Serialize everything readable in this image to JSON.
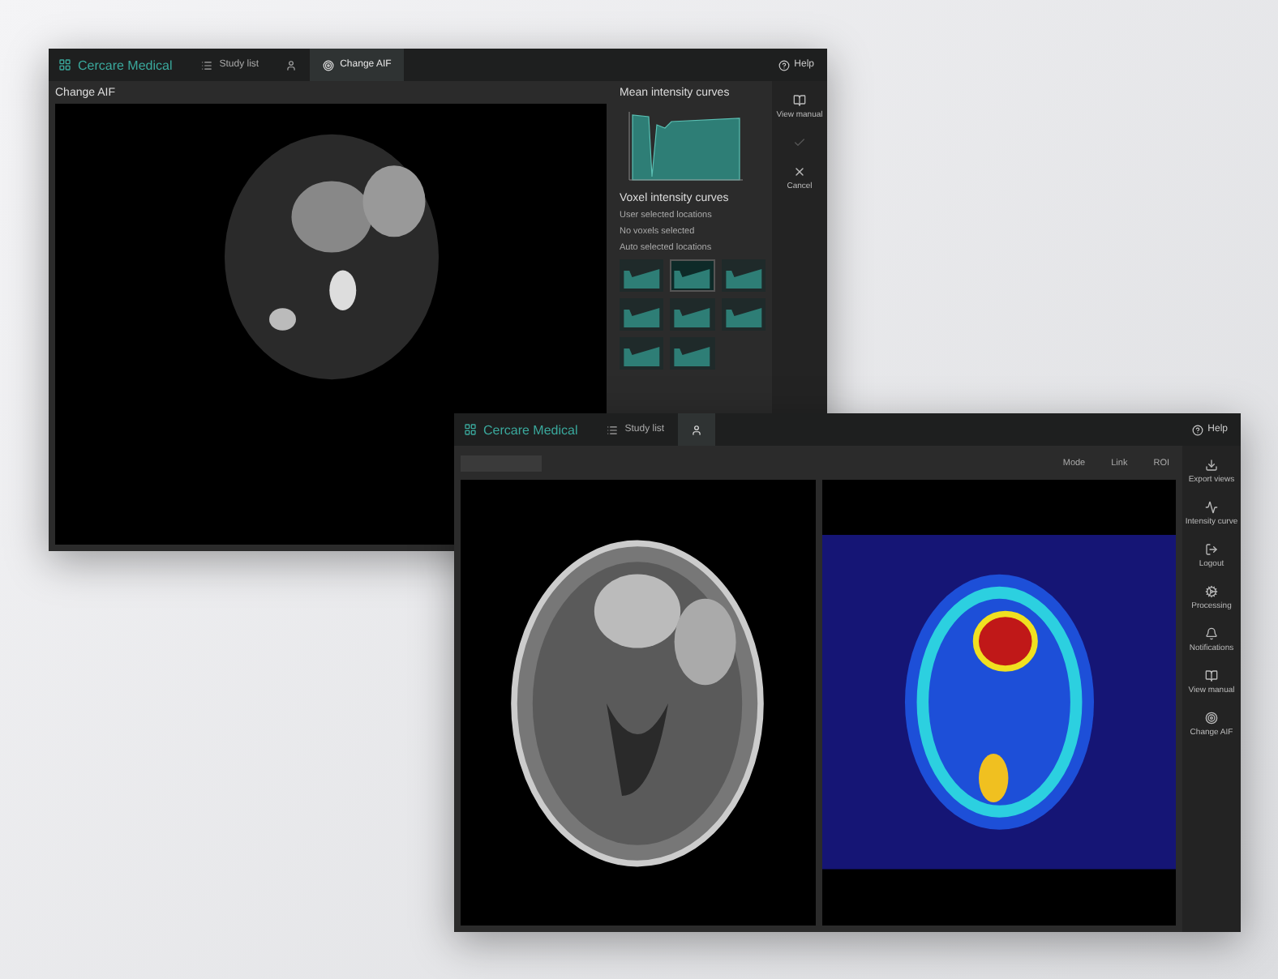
{
  "back_window": {
    "brand": "Cercare Medical",
    "help": "Help",
    "tabs": [
      {
        "kind": "list",
        "label": "Study list",
        "selected": false
      },
      {
        "kind": "patient",
        "selected": false
      },
      {
        "kind": "aif",
        "label": "Change AIF",
        "selected": true
      }
    ],
    "title": "Change AIF",
    "panel": {
      "mean_title": "Mean intensity curves",
      "voxel_title": "Voxel intensity curves",
      "user_locations": "User selected locations",
      "no_voxels": "No voxels selected",
      "auto_locations": "Auto selected locations",
      "thumbnails": [
        {
          "selected": false
        },
        {
          "selected": true
        },
        {
          "selected": false
        },
        {
          "selected": false
        },
        {
          "selected": false
        },
        {
          "selected": false
        },
        {
          "selected": false
        },
        {
          "selected": false
        }
      ]
    },
    "actions": [
      {
        "kind": "manual",
        "label": "View manual",
        "disabled": false
      },
      {
        "kind": "confirm",
        "disabled": true
      },
      {
        "kind": "cancel",
        "label": "Cancel",
        "disabled": false
      }
    ]
  },
  "front_window": {
    "brand": "Cercare Medical",
    "help": "Help",
    "tabs": [
      {
        "kind": "list",
        "label": "Study list",
        "selected": false
      },
      {
        "kind": "patient",
        "selected": true
      }
    ],
    "toolbar": [
      "Mode",
      "Link",
      "ROI"
    ],
    "sidebar": [
      {
        "kind": "export",
        "label": "Export views"
      },
      {
        "kind": "curve",
        "label": "Intensity curve"
      },
      {
        "kind": "logout",
        "label": "Logout"
      },
      {
        "kind": "processing",
        "label": "Processing"
      },
      {
        "kind": "notifications",
        "label": "Notifications"
      },
      {
        "kind": "manual",
        "label": "View manual"
      },
      {
        "kind": "aif",
        "label": "Change AIF"
      }
    ]
  }
}
